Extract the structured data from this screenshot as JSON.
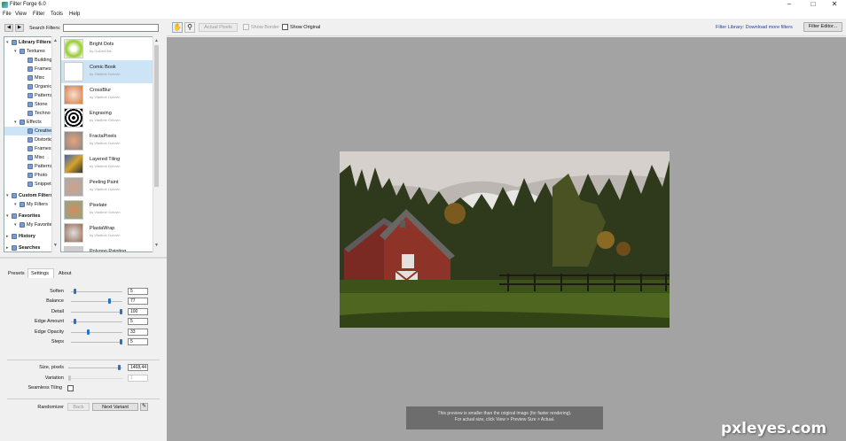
{
  "app": {
    "title": "Filter Forge 6.0",
    "icon": "filter-forge-logo-icon"
  },
  "window_controls": {
    "minimize": "–",
    "maximize": "□",
    "close": "✕"
  },
  "menu": [
    "File",
    "View",
    "Filter",
    "Tools",
    "Help"
  ],
  "search": {
    "label": "Search Filters:",
    "value": ""
  },
  "tree": [
    {
      "label": "Library Filters",
      "bold": true
    },
    {
      "label": "Textures"
    },
    {
      "label": "Building"
    },
    {
      "label": "Frames"
    },
    {
      "label": "Misc"
    },
    {
      "label": "Organic"
    },
    {
      "label": "Patterns"
    },
    {
      "label": "Stone"
    },
    {
      "label": "Techno"
    },
    {
      "label": "Effects"
    },
    {
      "label": "Creative",
      "selected": true
    },
    {
      "label": "Distortion"
    },
    {
      "label": "Frames"
    },
    {
      "label": "Misc"
    },
    {
      "label": "Patterns"
    },
    {
      "label": "Photo"
    },
    {
      "label": "Snippets"
    },
    {
      "label": "Custom Filters",
      "bold": true
    },
    {
      "label": "My Filters"
    },
    {
      "label": "Favorites",
      "bold": true
    },
    {
      "label": "My Favorites"
    },
    {
      "label": "History",
      "bold": true
    },
    {
      "label": "Searches",
      "bold": true
    }
  ],
  "filters": [
    {
      "name": "Bright Dots",
      "author": "by GoDsIGNs"
    },
    {
      "name": "Comic Book",
      "author": "by Vladimir Golovin",
      "selected": true
    },
    {
      "name": "CrossBlur",
      "author": "by Vladimir Golovin"
    },
    {
      "name": "Engraving",
      "author": "by Vladimir Golovin"
    },
    {
      "name": "FractaPixels",
      "author": "by Vladimir Golovin"
    },
    {
      "name": "Layered Tiling",
      "author": "by Vladimir Golovin"
    },
    {
      "name": "Peeling Paint",
      "author": "by Vladimir Golovin"
    },
    {
      "name": "Pixelate",
      "author": "by Vladimir Golovin"
    },
    {
      "name": "PlastaWrap",
      "author": "by Vladimir Golovin"
    },
    {
      "name": "Polygon Painting",
      "author": ""
    }
  ],
  "tabs": {
    "presets": "Presets",
    "settings": "Settings",
    "about": "About"
  },
  "settings": [
    {
      "label": "Soften",
      "value": "5",
      "level": 0.05
    },
    {
      "label": "Balance",
      "value": "77",
      "level": 0.77
    },
    {
      "label": "Detail",
      "value": "100",
      "level": 1.0
    },
    {
      "label": "Edge Amount",
      "value": "5",
      "level": 0.05
    },
    {
      "label": "Edge Opacity",
      "value": "33",
      "level": 0.33
    },
    {
      "label": "Steps",
      "value": "5",
      "level": 1.0
    }
  ],
  "size": {
    "label": "Size, pixels",
    "value": "1468,44",
    "level": 0.97
  },
  "variation": {
    "label": "Variation",
    "value": "1",
    "level": 0.0
  },
  "seamless": {
    "label": "Seamless Tiling"
  },
  "randomizer": {
    "label": "Randomizer",
    "back": "Back",
    "next": "Next Variant"
  },
  "toolbar": {
    "actual_pixels": "Actual Pixels",
    "show_border": "Show Border",
    "show_original": "Show Original",
    "library_link": "Filter Library: Download more filters",
    "filter_editor": "Filter Editor..."
  },
  "notice": {
    "line1": "This preview is smaller than the original image (for faster rendering).",
    "line2": "For actual size, click View > Preview Size > Actual."
  },
  "watermark": "pxleyes.com",
  "colors": {
    "accent": "#2a6fc9",
    "selection": "#cde4f7",
    "canvas": "#a3a3a3",
    "link": "#1a3fa6"
  }
}
